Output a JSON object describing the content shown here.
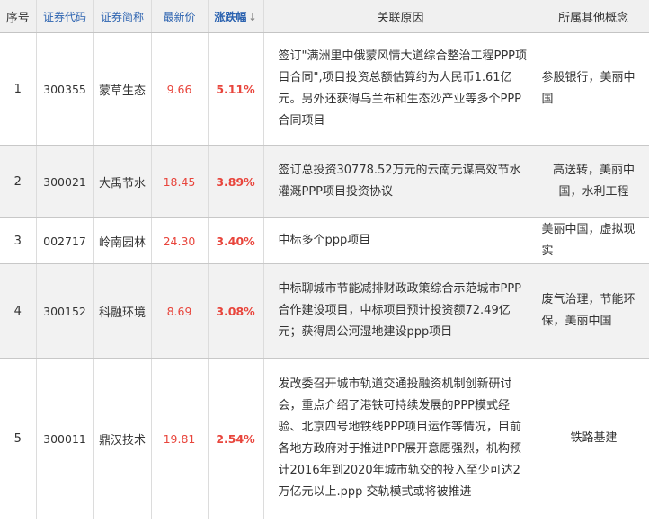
{
  "header": {
    "col_index": "序号",
    "col_code": "证券代码",
    "col_name": "证券简称",
    "col_price": "最新价",
    "col_change": "涨跌幅",
    "col_change_sort_icon": "arrow-down-icon",
    "col_reason": "关联原因",
    "col_concepts": "所属其他概念"
  },
  "colors": {
    "header_link": "#2c63b0",
    "up_red": "#e8453c",
    "row_alt_bg": "#f2f2f2",
    "header_bg": "#f0f0f0"
  },
  "rows": [
    {
      "index": "1",
      "code": "300355",
      "name": "蒙草生态",
      "price": "9.66",
      "change": "5.11%",
      "reason": "签订\"满洲里中俄蒙风情大道综合整治工程PPP项目合同\",项目投资总额估算约为人民币1.61亿元。另外还获得乌兰布和生态沙产业等多个PPP合同项目",
      "concepts": "参股银行，美丽中国"
    },
    {
      "index": "2",
      "code": "300021",
      "name": "大禹节水",
      "price": "18.45",
      "change": "3.89%",
      "reason": "签订总投资30778.52万元的云南元谋高效节水灌溉PPP项目投资协议",
      "concepts": "高送转，美丽中国，水利工程"
    },
    {
      "index": "3",
      "code": "002717",
      "name": "岭南园林",
      "price": "24.30",
      "change": "3.40%",
      "reason": "中标多个ppp项目",
      "concepts": "美丽中国，虚拟现实"
    },
    {
      "index": "4",
      "code": "300152",
      "name": "科融环境",
      "price": "8.69",
      "change": "3.08%",
      "reason": "中标聊城市节能减排财政政策综合示范城市PPP合作建设项目，中标项目预计投资额72.49亿元；获得周公河湿地建设ppp项目",
      "concepts": "废气治理，节能环保，美丽中国"
    },
    {
      "index": "5",
      "code": "300011",
      "name": "鼎汉技术",
      "price": "19.81",
      "change": "2.54%",
      "reason": "发改委召开城市轨道交通投融资机制创新研讨会，重点介绍了港铁可持续发展的PPP模式经验、北京四号地铁线PPP项目运作等情况，目前各地方政府对于推进PPP展开意愿强烈，机构预计2016年到2020年城市轨交的投入至少可达2万亿元以上.ppp 交轨模式或将被推进",
      "concepts": "铁路基建"
    }
  ]
}
